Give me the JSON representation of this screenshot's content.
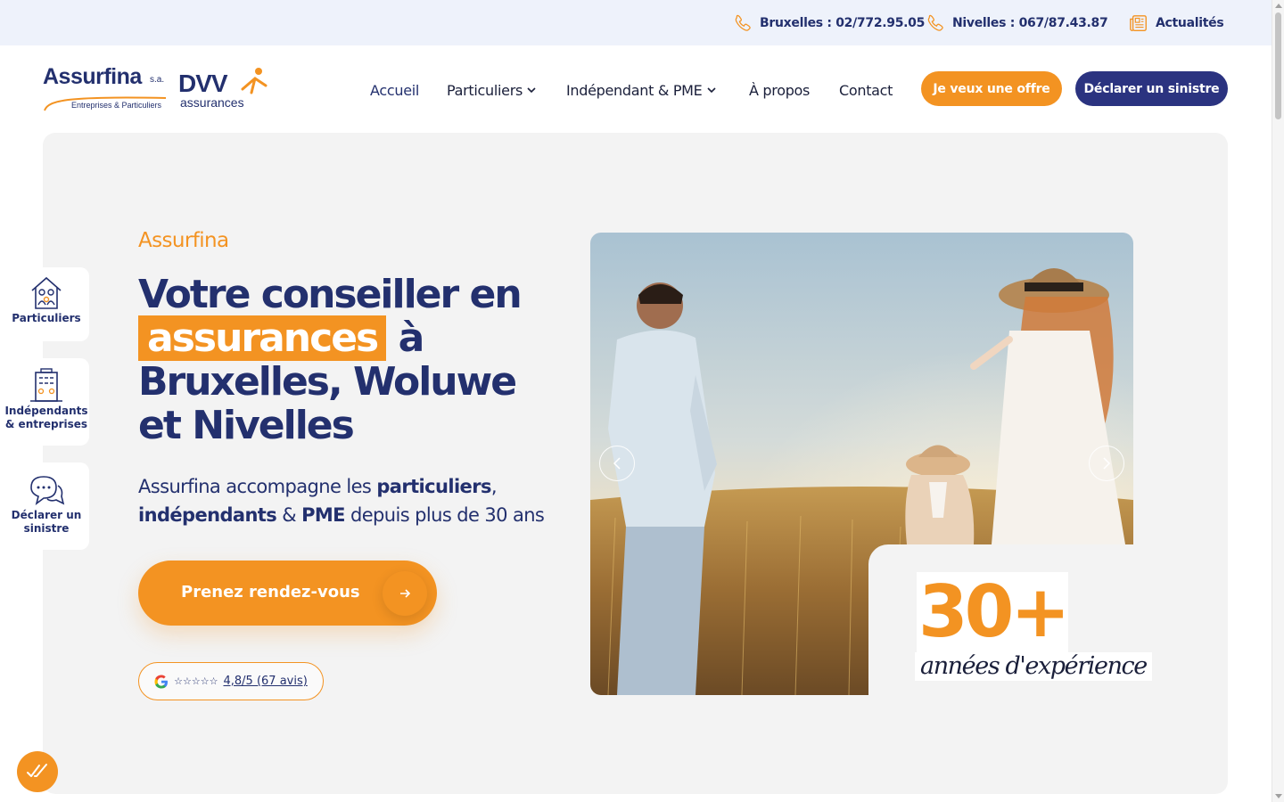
{
  "topbar": {
    "bruxelles": "Bruxelles : 02/772.95.05",
    "nivelles": "Nivelles : 067/87.43.87",
    "news": "Actualités"
  },
  "logo": {
    "brand": "Assurfina",
    "suffix": "s.a.",
    "tagline": "Entreprises & Particuliers",
    "partner": "DVV",
    "partner_sub": "assurances"
  },
  "nav": {
    "home": "Accueil",
    "individuals": "Particuliers",
    "business": "Indépendant & PME",
    "about": "À propos",
    "contact": "Contact"
  },
  "cta": {
    "offer": "Je veux une offre",
    "claim": "Déclarer un sinistre"
  },
  "hero": {
    "kicker": "Assurfina",
    "title_1": "Votre conseiller en",
    "title_highlight": "assurances",
    "title_2": "à",
    "title_3": "Bruxelles, Woluwe et Nivelles",
    "lead_1": "Assurfina accompagne les",
    "lead_b1": "particuliers",
    "lead_2": ",",
    "lead_b2": "indépendants",
    "lead_3": "&",
    "lead_b3": "PME",
    "lead_4": "depuis plus de 30 ans",
    "button": "Prenez rendez-vous",
    "reviews_score": "4,8/5 (67 avis)",
    "reviews_stars": "☆☆☆☆☆",
    "stat_number": "30+",
    "stat_label": "années d'expérience"
  },
  "sidetabs": {
    "individuals": "Particuliers",
    "business": "Indépendants & entreprises",
    "claim": "Déclarer un sinistre"
  },
  "colors": {
    "navy": "#23306e",
    "orange": "#f39322",
    "button_navy": "#2b3380",
    "panel": "#f3f3f3",
    "topbar": "#eef2fb"
  }
}
